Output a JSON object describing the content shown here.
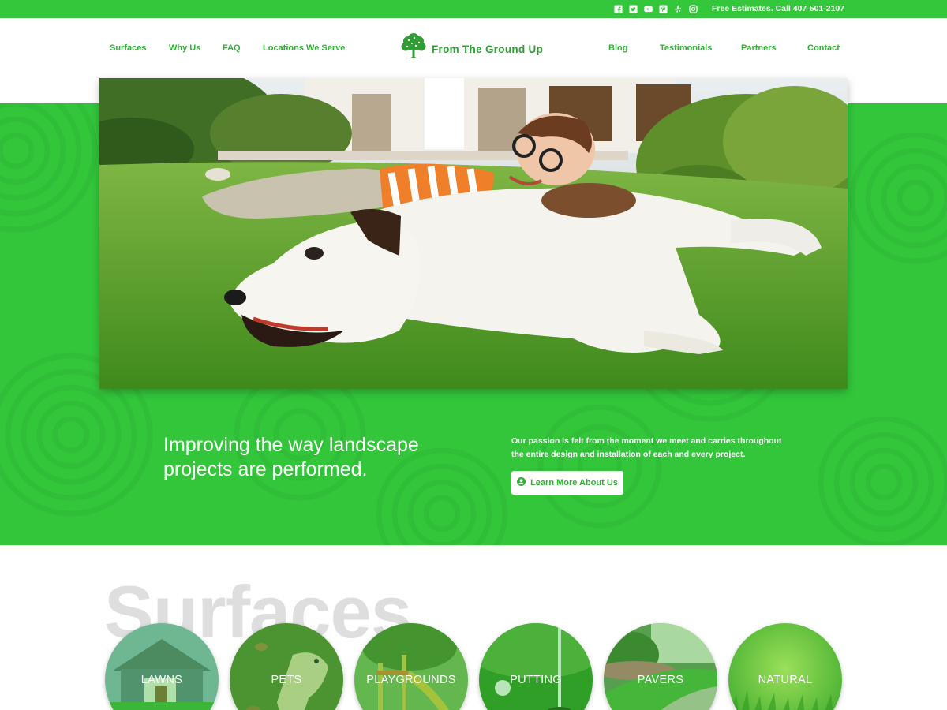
{
  "topbar": {
    "social_icons": [
      "facebook-icon",
      "twitter-icon",
      "youtube-icon",
      "pinterest-icon",
      "yelp-icon",
      "instagram-icon"
    ],
    "estimate_text": "Free Estimates. Call 407-501-2107"
  },
  "nav": {
    "left": [
      {
        "label": "Surfaces"
      },
      {
        "label": "Why Us"
      },
      {
        "label": "FAQ"
      },
      {
        "label": "Locations We Serve"
      }
    ],
    "right": [
      {
        "label": "Blog"
      },
      {
        "label": "Testimonials"
      },
      {
        "label": "Partners"
      },
      {
        "label": "Contact"
      }
    ]
  },
  "logo": {
    "text": "From The Ground Up",
    "icon": "tree-icon"
  },
  "hero": {
    "tagline": "Improving the way landscape projects are performed.",
    "description": "Our passion is felt from the moment we meet and carries throughout the entire design and installation of each and every project.",
    "cta_label": "Learn More About Us",
    "cta_icon": "user-circle-icon"
  },
  "surfaces": {
    "heading": "Surfaces",
    "items": [
      {
        "label": "LAWNS"
      },
      {
        "label": "PETS"
      },
      {
        "label": "PLAYGROUNDS"
      },
      {
        "label": "PUTTING"
      },
      {
        "label": "PAVERS"
      },
      {
        "label": "NATURAL"
      }
    ]
  },
  "colors": {
    "brand_green": "#34c63b",
    "link_green": "#2fb233",
    "logo_green": "#2f9e34"
  }
}
